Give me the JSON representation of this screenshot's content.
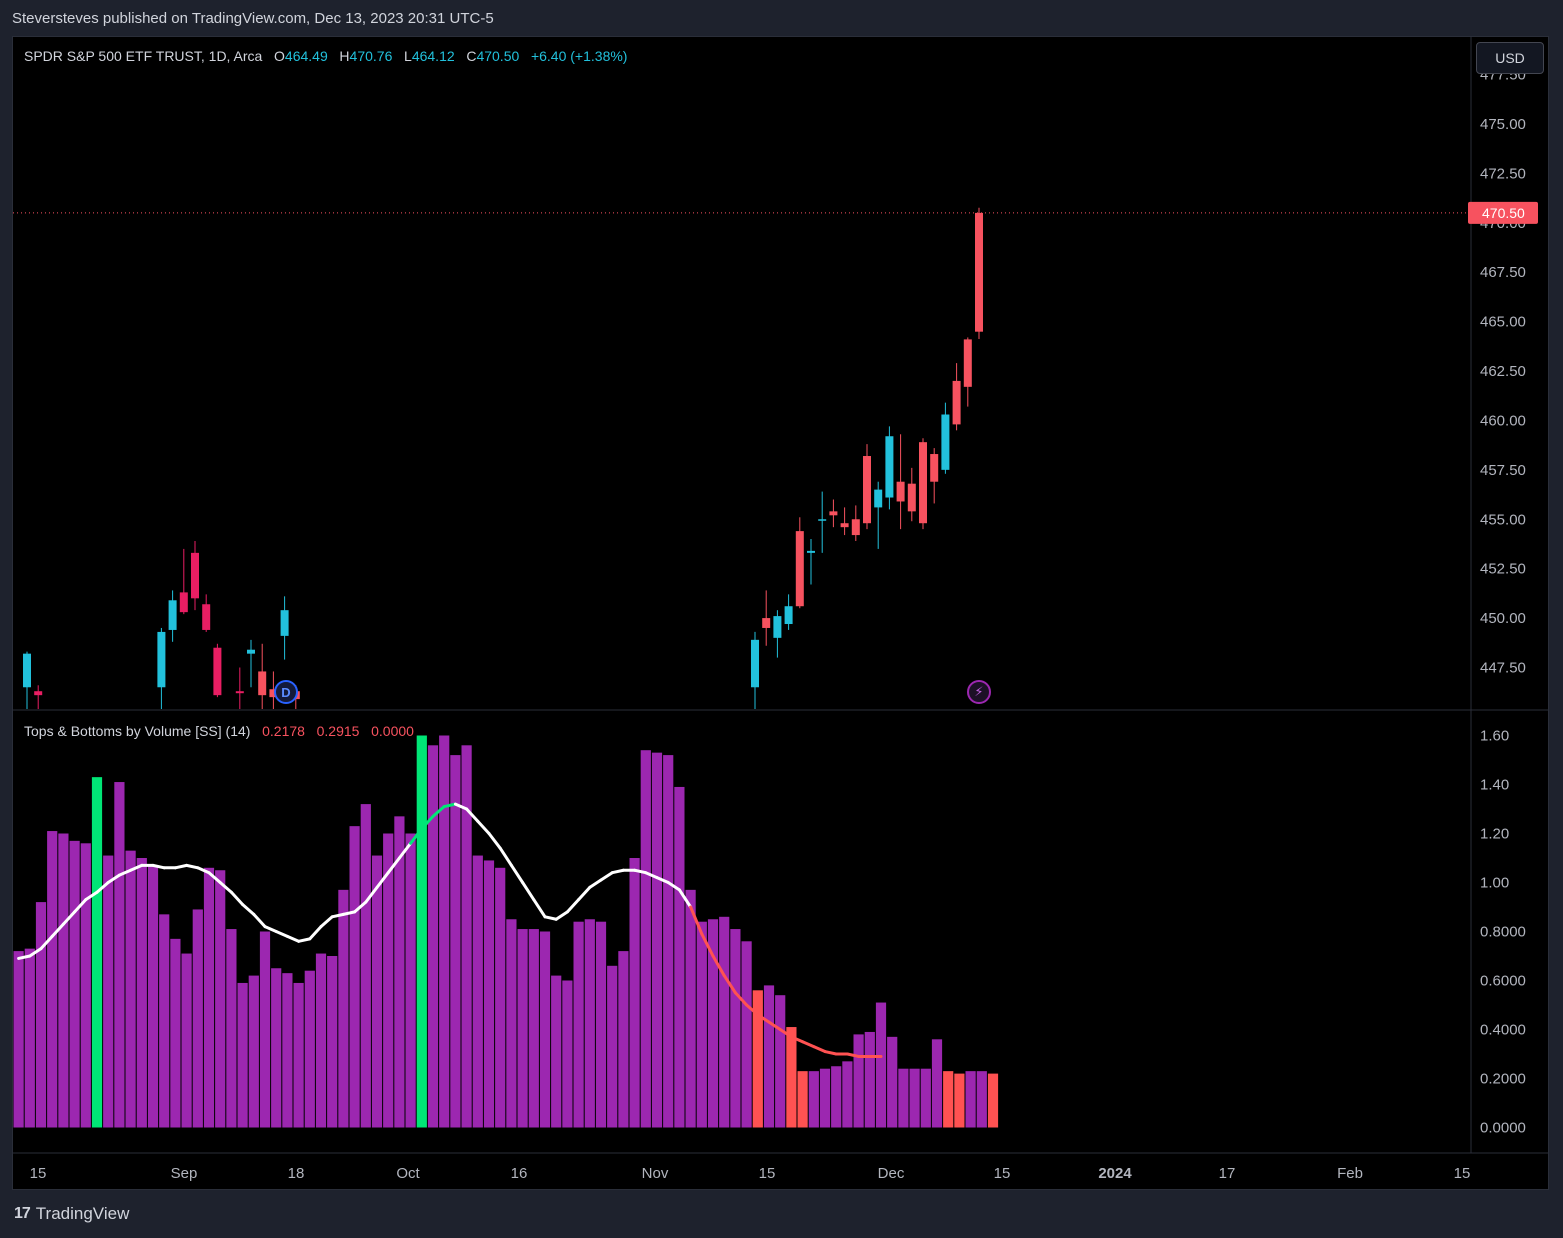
{
  "header": {
    "publisher_line": "Steversteves published on TradingView.com, Dec 13, 2023 20:31 UTC-5"
  },
  "main_legend": {
    "symbol": "SPDR S&P 500 ETF TRUST, 1D, Arca",
    "o_label": "O",
    "o_value": "464.49",
    "h_label": "H",
    "h_value": "470.76",
    "l_label": "L",
    "l_value": "464.12",
    "c_label": "C",
    "c_value": "470.50",
    "change": "+6.40 (+1.38%)"
  },
  "indicator_legend": {
    "name": "Tops & Bottoms by Volume [SS] (14)",
    "v1": "0.2178",
    "v2": "0.2915",
    "v3": "0.0000"
  },
  "currency_button": "USD",
  "last_price_label": "470.50",
  "footer": {
    "brand": "TradingView"
  },
  "markers": {
    "dividend": "D",
    "earnings": "⚡"
  },
  "colors": {
    "up": "#22c1dc",
    "down": "#f7525f",
    "neutral_bull": "#2ee07a",
    "down_magenta": "#e91e63",
    "volume_bar": "#9c27b0",
    "volume_high": "#00e676",
    "volume_low": "#ff5252",
    "ma_white": "#ffffff",
    "ma_green": "#00e676",
    "ma_red": "#ff5252"
  },
  "chart_data": [
    {
      "type": "candlestick",
      "title": "SPDR S&P 500 ETF TRUST, 1D, Arca",
      "y_axis_labels": [
        "477.50",
        "475.00",
        "472.50",
        "470.00",
        "467.50",
        "465.00",
        "462.50",
        "460.00",
        "457.50",
        "455.00",
        "452.50",
        "450.00",
        "447.50"
      ],
      "x_axis_labels": [
        "15",
        "Sep",
        "18",
        "Oct",
        "16",
        "Nov",
        "15",
        "Dec",
        "15",
        "2024",
        "17",
        "Feb",
        "15"
      ],
      "ylim": [
        445.4,
        479.4
      ],
      "candles": [
        {
          "i": 0,
          "o": 446.5,
          "h": 448.3,
          "l": 445.0,
          "c": 448.2
        },
        {
          "i": 1,
          "o": 446.3,
          "h": 446.6,
          "l": 445.0,
          "c": 446.1
        },
        {
          "i": 12,
          "o": 446.5,
          "h": 449.5,
          "l": 445.0,
          "c": 449.3
        },
        {
          "i": 13,
          "o": 449.4,
          "h": 451.4,
          "l": 448.8,
          "c": 450.9
        },
        {
          "i": 14,
          "o": 451.3,
          "h": 453.5,
          "l": 450.2,
          "c": 450.3
        },
        {
          "i": 15,
          "o": 453.3,
          "h": 453.9,
          "l": 450.4,
          "c": 451.0
        },
        {
          "i": 16,
          "o": 450.7,
          "h": 451.2,
          "l": 449.3,
          "c": 449.4
        },
        {
          "i": 17,
          "o": 448.5,
          "h": 448.7,
          "l": 446.0,
          "c": 446.1
        },
        {
          "i": 19,
          "o": 446.3,
          "h": 447.5,
          "l": 445.0,
          "c": 446.2
        },
        {
          "i": 20,
          "o": 448.2,
          "h": 448.9,
          "l": 446.5,
          "c": 448.4
        },
        {
          "i": 21,
          "o": 447.3,
          "h": 448.7,
          "l": 445.0,
          "c": 446.1
        },
        {
          "i": 22,
          "o": 446.4,
          "h": 447.3,
          "l": 445.0,
          "c": 446.0
        },
        {
          "i": 23,
          "o": 449.1,
          "h": 451.1,
          "l": 447.9,
          "c": 450.4
        },
        {
          "i": 24,
          "o": 446.3,
          "h": 446.6,
          "l": 445.0,
          "c": 445.9
        },
        {
          "i": 65,
          "o": 446.5,
          "h": 449.3,
          "l": 445.0,
          "c": 448.9
        },
        {
          "i": 66,
          "o": 450.0,
          "h": 451.4,
          "l": 448.6,
          "c": 449.5
        },
        {
          "i": 67,
          "o": 449.0,
          "h": 450.4,
          "l": 448.0,
          "c": 450.1
        },
        {
          "i": 68,
          "o": 449.7,
          "h": 451.2,
          "l": 449.4,
          "c": 450.6
        },
        {
          "i": 69,
          "o": 454.4,
          "h": 455.1,
          "l": 450.5,
          "c": 450.6
        },
        {
          "i": 70,
          "o": 453.3,
          "h": 454.0,
          "l": 451.7,
          "c": 453.4
        },
        {
          "i": 71,
          "o": 455.0,
          "h": 456.4,
          "l": 453.3,
          "c": 455.0
        },
        {
          "i": 72,
          "o": 455.4,
          "h": 456.0,
          "l": 454.6,
          "c": 455.2
        },
        {
          "i": 73,
          "o": 454.8,
          "h": 455.6,
          "l": 454.2,
          "c": 454.6
        },
        {
          "i": 74,
          "o": 455.0,
          "h": 455.7,
          "l": 453.9,
          "c": 454.2
        },
        {
          "i": 75,
          "o": 458.2,
          "h": 458.8,
          "l": 454.5,
          "c": 454.8
        },
        {
          "i": 76,
          "o": 455.6,
          "h": 456.9,
          "l": 453.5,
          "c": 456.5
        },
        {
          "i": 77,
          "o": 456.1,
          "h": 459.7,
          "l": 455.5,
          "c": 459.2
        },
        {
          "i": 78,
          "o": 456.9,
          "h": 459.3,
          "l": 454.5,
          "c": 455.9
        },
        {
          "i": 79,
          "o": 456.8,
          "h": 457.6,
          "l": 454.9,
          "c": 455.4
        },
        {
          "i": 80,
          "o": 458.9,
          "h": 459.1,
          "l": 454.5,
          "c": 454.8
        },
        {
          "i": 81,
          "o": 458.3,
          "h": 458.6,
          "l": 455.8,
          "c": 456.9
        },
        {
          "i": 82,
          "o": 457.5,
          "h": 460.9,
          "l": 457.3,
          "c": 460.3
        },
        {
          "i": 83,
          "o": 462.0,
          "h": 462.9,
          "l": 459.5,
          "c": 459.8
        },
        {
          "i": 84,
          "o": 464.1,
          "h": 464.2,
          "l": 460.7,
          "c": 461.7
        },
        {
          "i": 85,
          "o": 470.5,
          "h": 470.76,
          "l": 464.12,
          "c": 464.49
        }
      ]
    },
    {
      "type": "bar",
      "title": "Tops & Bottoms by Volume [SS] (14)",
      "y_axis_labels": [
        "1.60",
        "1.40",
        "1.20",
        "1.00",
        "0.8000",
        "0.6000",
        "0.4000",
        "0.2000",
        "0.0000"
      ],
      "ylim": [
        -0.1,
        1.7
      ],
      "values": [
        0.72,
        0.73,
        0.92,
        1.21,
        1.2,
        1.17,
        1.16,
        1.43,
        1.11,
        1.41,
        1.13,
        1.1,
        1.07,
        0.87,
        0.77,
        0.71,
        0.89,
        1.06,
        1.05,
        0.81,
        0.59,
        0.62,
        0.8,
        0.65,
        0.63,
        0.59,
        0.64,
        0.71,
        0.7,
        0.97,
        1.23,
        1.32,
        1.11,
        1.2,
        1.27,
        1.2,
        1.6,
        1.56,
        1.6,
        1.52,
        1.56,
        1.11,
        1.09,
        1.06,
        0.85,
        0.81,
        0.81,
        0.8,
        0.62,
        0.6,
        0.84,
        0.85,
        0.84,
        0.66,
        0.72,
        1.1,
        1.54,
        1.53,
        1.52,
        1.39,
        0.97,
        0.84,
        0.85,
        0.86,
        0.81,
        0.76,
        0.56,
        0.58,
        0.54,
        0.41,
        0.23,
        0.23,
        0.24,
        0.25,
        0.27,
        0.38,
        0.39,
        0.51,
        0.37,
        0.24,
        0.24,
        0.24,
        0.36,
        0.23,
        0.22,
        0.23,
        0.23,
        0.22
      ],
      "bar_states": [
        "n",
        "n",
        "n",
        "n",
        "n",
        "n",
        "n",
        "h",
        "n",
        "n",
        "n",
        "n",
        "n",
        "n",
        "n",
        "n",
        "n",
        "n",
        "n",
        "n",
        "n",
        "n",
        "n",
        "n",
        "n",
        "n",
        "n",
        "n",
        "n",
        "n",
        "n",
        "n",
        "n",
        "n",
        "n",
        "n",
        "h",
        "n",
        "n",
        "n",
        "n",
        "n",
        "n",
        "n",
        "n",
        "n",
        "n",
        "n",
        "n",
        "n",
        "n",
        "n",
        "n",
        "n",
        "n",
        "n",
        "n",
        "n",
        "n",
        "n",
        "n",
        "n",
        "n",
        "n",
        "n",
        "n",
        "l",
        "n",
        "n",
        "l",
        "l",
        "n",
        "n",
        "n",
        "n",
        "n",
        "n",
        "n",
        "n",
        "n",
        "n",
        "n",
        "n",
        "l",
        "l",
        "n",
        "n",
        "l"
      ],
      "ma_line": [
        0.69,
        0.7,
        0.73,
        0.78,
        0.83,
        0.88,
        0.93,
        0.96,
        1.0,
        1.03,
        1.05,
        1.07,
        1.07,
        1.06,
        1.06,
        1.07,
        1.06,
        1.04,
        1.0,
        0.96,
        0.91,
        0.87,
        0.82,
        0.8,
        0.78,
        0.76,
        0.77,
        0.82,
        0.86,
        0.87,
        0.88,
        0.92,
        0.98,
        1.04,
        1.1,
        1.16,
        1.22,
        1.27,
        1.31,
        1.32,
        1.3,
        1.25,
        1.2,
        1.14,
        1.07,
        1.0,
        0.93,
        0.86,
        0.85,
        0.88,
        0.93,
        0.98,
        1.01,
        1.04,
        1.05,
        1.05,
        1.04,
        1.02,
        1.0,
        0.97,
        0.9,
        0.79,
        0.7,
        0.62,
        0.55,
        0.5,
        0.46,
        0.43,
        0.4,
        0.37,
        0.35,
        0.33,
        0.31,
        0.3,
        0.3,
        0.29,
        0.29,
        0.29
      ],
      "ma_states": [
        "w",
        "w",
        "w",
        "w",
        "w",
        "w",
        "w",
        "w",
        "w",
        "w",
        "w",
        "w",
        "w",
        "w",
        "w",
        "w",
        "w",
        "w",
        "w",
        "w",
        "w",
        "w",
        "w",
        "w",
        "w",
        "w",
        "w",
        "w",
        "w",
        "w",
        "w",
        "w",
        "w",
        "w",
        "w",
        "w",
        "g",
        "g",
        "g",
        "g",
        "w",
        "w",
        "w",
        "w",
        "w",
        "w",
        "w",
        "w",
        "w",
        "w",
        "w",
        "w",
        "w",
        "w",
        "w",
        "w",
        "w",
        "w",
        "w",
        "w",
        "w",
        "r",
        "r",
        "r",
        "r",
        "r",
        "r",
        "r",
        "r",
        "r",
        "r",
        "r",
        "r",
        "r",
        "r",
        "r",
        "r",
        "r"
      ]
    }
  ]
}
